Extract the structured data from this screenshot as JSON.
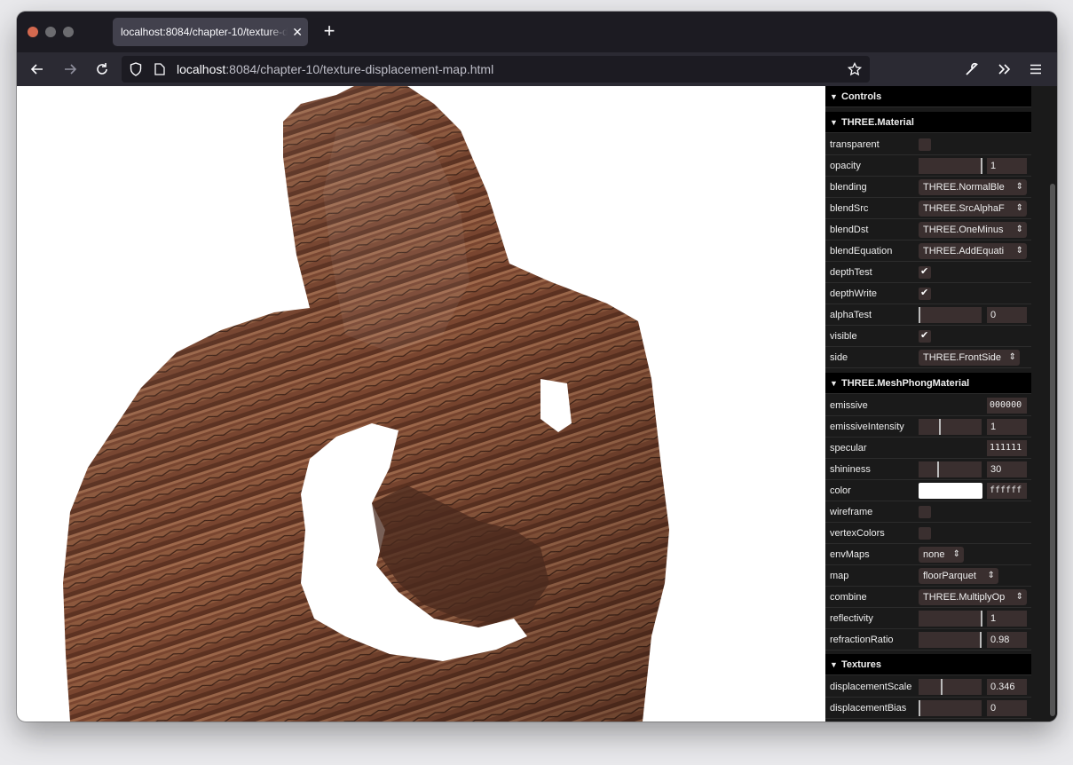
{
  "browser": {
    "tab_title": "localhost:8084/chapter-10/texture-displacement-map.html",
    "tab_title_visible": "localhost:8084/chapter-10/texture-d",
    "url_host": "localhost",
    "url_rest": ":8084/chapter-10/texture-displacement-map.html",
    "icons": [
      "back-arrow-icon",
      "forward-arrow-icon",
      "reload-icon",
      "shield-icon",
      "page-icon",
      "star-icon",
      "wrench-icon",
      "chevrons-right-icon",
      "hamburger-menu-icon",
      "close-icon",
      "plus-icon"
    ]
  },
  "gui": {
    "controls_label": "Controls",
    "material_folder": "THREE.Material",
    "material": {
      "transparent": {
        "label": "transparent",
        "checked": false
      },
      "opacity": {
        "label": "opacity",
        "value": "1",
        "level": 1.0
      },
      "blending": {
        "label": "blending",
        "value": "THREE.NormalBle"
      },
      "blendSrc": {
        "label": "blendSrc",
        "value": "THREE.SrcAlphaF"
      },
      "blendDst": {
        "label": "blendDst",
        "value": "THREE.OneMinus"
      },
      "blendEquation": {
        "label": "blendEquation",
        "value": "THREE.AddEquati"
      },
      "depthTest": {
        "label": "depthTest",
        "checked": true
      },
      "depthWrite": {
        "label": "depthWrite",
        "checked": true
      },
      "alphaTest": {
        "label": "alphaTest",
        "value": "0",
        "level": 0.0
      },
      "visible": {
        "label": "visible",
        "checked": true
      },
      "side": {
        "label": "side",
        "value": "THREE.FrontSide"
      }
    },
    "phong_folder": "THREE.MeshPhongMaterial",
    "phong": {
      "emissive": {
        "label": "emissive",
        "value": "000000"
      },
      "emissiveIntensity": {
        "label": "emissiveIntensity",
        "value": "1",
        "level": 0.33
      },
      "specular": {
        "label": "specular",
        "value": "111111"
      },
      "shininess": {
        "label": "shininess",
        "value": "30",
        "level": 0.3
      },
      "color": {
        "label": "color",
        "value": "ffffff",
        "swatch": "#ffffff"
      },
      "wireframe": {
        "label": "wireframe",
        "checked": false
      },
      "vertexColors": {
        "label": "vertexColors",
        "checked": false
      },
      "envMaps": {
        "label": "envMaps",
        "value": "none"
      },
      "map": {
        "label": "map",
        "value": "floorParquet"
      },
      "combine": {
        "label": "combine",
        "value": "THREE.MultiplyOp"
      },
      "reflectivity": {
        "label": "reflectivity",
        "value": "1",
        "level": 1.0
      },
      "refractionRatio": {
        "label": "refractionRatio",
        "value": "0.98",
        "level": 0.98
      }
    },
    "textures_folder": "Textures",
    "textures": {
      "displacementScale": {
        "label": "displacementScale",
        "value": "0.346",
        "level": 0.346
      },
      "displacementBias": {
        "label": "displacementBias",
        "value": "0",
        "level": 0.0
      }
    }
  },
  "colors": {
    "wood_dark": "#5a3322",
    "wood_mid": "#8a5238",
    "wood_light": "#b07a5c"
  }
}
